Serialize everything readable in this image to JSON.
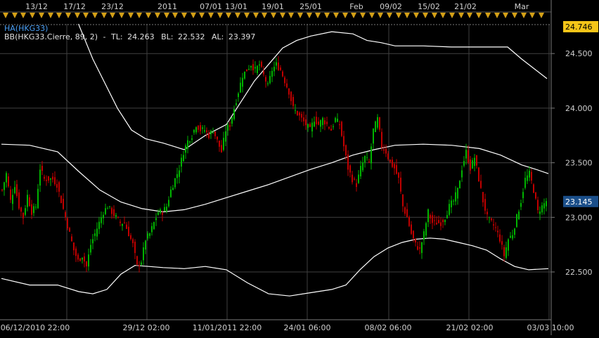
{
  "chart_data": {
    "type": "candlestick",
    "instrument": "HA(HKG33)",
    "indicator": {
      "label": "BB(HKG33.Cierre, 89, 2)",
      "tl_label": "TL:",
      "tl_value": "24.263",
      "bl_label": "BL:",
      "bl_value": "22.532",
      "al_label": "AL:",
      "al_value": "23.397",
      "separator": "-"
    },
    "ylim": [
      22.0,
      24.85
    ],
    "y_ticks": [
      "24.500",
      "24.000",
      "23.500",
      "23.000",
      "22.500"
    ],
    "last_price": "23.145",
    "high_marker": "24.746",
    "top_labels": [
      "13/12",
      "17/12",
      "23/12",
      "2011",
      "07/01",
      "13/01",
      "19/01",
      "25/01",
      "Feb",
      "09/02",
      "15/02",
      "21/02",
      "Mar"
    ],
    "bottom_labels": [
      "06/12/2010 22:00",
      "29/12 02:00",
      "11/01/2011 22:00",
      "24/01 06:00",
      "08/02 06:00",
      "21/02 02:00",
      "03/03 10:00"
    ],
    "close_path": [
      [
        0,
        23.25
      ],
      [
        6,
        23.4
      ],
      [
        12,
        23.15
      ],
      [
        18,
        23.3
      ],
      [
        24,
        23.1
      ],
      [
        30,
        23.0
      ],
      [
        36,
        23.2
      ],
      [
        42,
        23.05
      ],
      [
        48,
        23.1
      ],
      [
        54,
        23.45
      ],
      [
        60,
        23.35
      ],
      [
        66,
        23.35
      ],
      [
        72,
        23.35
      ],
      [
        78,
        23.3
      ],
      [
        84,
        23.15
      ],
      [
        90,
        23.0
      ],
      [
        96,
        22.85
      ],
      [
        102,
        22.7
      ],
      [
        108,
        22.6
      ],
      [
        114,
        22.65
      ],
      [
        120,
        22.55
      ],
      [
        126,
        22.75
      ],
      [
        132,
        22.85
      ],
      [
        138,
        22.95
      ],
      [
        144,
        23.05
      ],
      [
        150,
        23.1
      ],
      [
        156,
        23.05
      ],
      [
        162,
        23.0
      ],
      [
        168,
        22.95
      ],
      [
        174,
        22.95
      ],
      [
        180,
        22.85
      ],
      [
        186,
        22.75
      ],
      [
        192,
        22.55
      ],
      [
        198,
        22.6
      ],
      [
        204,
        22.8
      ],
      [
        210,
        22.85
      ],
      [
        216,
        22.95
      ],
      [
        222,
        23.05
      ],
      [
        228,
        23.05
      ],
      [
        234,
        23.1
      ],
      [
        240,
        23.25
      ],
      [
        246,
        23.35
      ],
      [
        252,
        23.45
      ],
      [
        258,
        23.6
      ],
      [
        264,
        23.7
      ],
      [
        270,
        23.75
      ],
      [
        276,
        23.85
      ],
      [
        282,
        23.8
      ],
      [
        288,
        23.8
      ],
      [
        294,
        23.75
      ],
      [
        300,
        23.8
      ],
      [
        306,
        23.7
      ],
      [
        312,
        23.6
      ],
      [
        318,
        23.8
      ],
      [
        324,
        23.85
      ],
      [
        330,
        24.0
      ],
      [
        336,
        24.15
      ],
      [
        342,
        24.3
      ],
      [
        348,
        24.35
      ],
      [
        354,
        24.4
      ],
      [
        360,
        24.35
      ],
      [
        366,
        24.4
      ],
      [
        372,
        24.3
      ],
      [
        378,
        24.2
      ],
      [
        384,
        24.35
      ],
      [
        390,
        24.4
      ],
      [
        396,
        24.35
      ],
      [
        402,
        24.25
      ],
      [
        408,
        24.15
      ],
      [
        414,
        24.0
      ],
      [
        420,
        23.95
      ],
      [
        426,
        23.9
      ],
      [
        432,
        23.85
      ],
      [
        438,
        23.8
      ],
      [
        444,
        23.9
      ],
      [
        450,
        23.85
      ],
      [
        456,
        23.9
      ],
      [
        462,
        23.85
      ],
      [
        468,
        23.8
      ],
      [
        474,
        23.9
      ],
      [
        480,
        23.85
      ],
      [
        486,
        23.65
      ],
      [
        492,
        23.45
      ],
      [
        498,
        23.35
      ],
      [
        504,
        23.3
      ],
      [
        510,
        23.45
      ],
      [
        516,
        23.55
      ],
      [
        522,
        23.5
      ],
      [
        528,
        23.8
      ],
      [
        534,
        23.9
      ],
      [
        540,
        23.65
      ],
      [
        546,
        23.6
      ],
      [
        552,
        23.5
      ],
      [
        558,
        23.45
      ],
      [
        564,
        23.35
      ],
      [
        570,
        23.1
      ],
      [
        576,
        23.0
      ],
      [
        582,
        22.85
      ],
      [
        588,
        22.75
      ],
      [
        594,
        22.7
      ],
      [
        600,
        22.85
      ],
      [
        606,
        23.05
      ],
      [
        612,
        22.95
      ],
      [
        618,
        22.95
      ],
      [
        624,
        22.95
      ],
      [
        630,
        23.0
      ],
      [
        636,
        23.1
      ],
      [
        642,
        23.15
      ],
      [
        648,
        23.25
      ],
      [
        654,
        23.45
      ],
      [
        660,
        23.6
      ],
      [
        666,
        23.45
      ],
      [
        672,
        23.55
      ],
      [
        678,
        23.35
      ],
      [
        684,
        23.15
      ],
      [
        690,
        23.0
      ],
      [
        696,
        22.95
      ],
      [
        702,
        22.9
      ],
      [
        708,
        22.8
      ],
      [
        714,
        22.65
      ],
      [
        720,
        22.8
      ],
      [
        726,
        22.85
      ],
      [
        732,
        23.0
      ],
      [
        738,
        23.15
      ],
      [
        744,
        23.35
      ],
      [
        750,
        23.4
      ],
      [
        756,
        23.25
      ],
      [
        762,
        23.05
      ],
      [
        768,
        23.1
      ],
      [
        774,
        23.15
      ]
    ],
    "upper_band": [
      [
        95,
        25.0
      ],
      [
        130,
        24.45
      ],
      [
        165,
        24.0
      ],
      [
        185,
        23.8
      ],
      [
        205,
        23.72
      ],
      [
        230,
        23.68
      ],
      [
        260,
        23.62
      ],
      [
        290,
        23.75
      ],
      [
        320,
        23.85
      ],
      [
        340,
        24.05
      ],
      [
        360,
        24.25
      ],
      [
        380,
        24.4
      ],
      [
        400,
        24.55
      ],
      [
        420,
        24.62
      ],
      [
        440,
        24.66
      ],
      [
        470,
        24.7
      ],
      [
        500,
        24.68
      ],
      [
        520,
        24.62
      ],
      [
        540,
        24.6
      ],
      [
        560,
        24.57
      ],
      [
        600,
        24.57
      ],
      [
        640,
        24.56
      ],
      [
        680,
        24.56
      ],
      [
        720,
        24.56
      ],
      [
        740,
        24.45
      ],
      [
        760,
        24.35
      ],
      [
        776,
        24.27
      ]
    ],
    "mid_band": [
      [
        0,
        23.67
      ],
      [
        40,
        23.66
      ],
      [
        80,
        23.6
      ],
      [
        110,
        23.42
      ],
      [
        140,
        23.25
      ],
      [
        170,
        23.14
      ],
      [
        200,
        23.08
      ],
      [
        230,
        23.05
      ],
      [
        260,
        23.07
      ],
      [
        290,
        23.12
      ],
      [
        320,
        23.18
      ],
      [
        350,
        23.24
      ],
      [
        380,
        23.3
      ],
      [
        410,
        23.37
      ],
      [
        440,
        23.44
      ],
      [
        470,
        23.5
      ],
      [
        500,
        23.57
      ],
      [
        530,
        23.62
      ],
      [
        560,
        23.66
      ],
      [
        600,
        23.67
      ],
      [
        640,
        23.66
      ],
      [
        680,
        23.63
      ],
      [
        710,
        23.57
      ],
      [
        740,
        23.48
      ],
      [
        760,
        23.44
      ],
      [
        778,
        23.4
      ]
    ],
    "lower_band": [
      [
        0,
        22.44
      ],
      [
        40,
        22.38
      ],
      [
        80,
        22.38
      ],
      [
        110,
        22.32
      ],
      [
        130,
        22.3
      ],
      [
        150,
        22.34
      ],
      [
        170,
        22.48
      ],
      [
        190,
        22.56
      ],
      [
        210,
        22.55
      ],
      [
        230,
        22.54
      ],
      [
        260,
        22.53
      ],
      [
        290,
        22.55
      ],
      [
        320,
        22.52
      ],
      [
        350,
        22.4
      ],
      [
        380,
        22.3
      ],
      [
        410,
        22.28
      ],
      [
        440,
        22.31
      ],
      [
        470,
        22.34
      ],
      [
        490,
        22.38
      ],
      [
        510,
        22.52
      ],
      [
        530,
        22.64
      ],
      [
        550,
        22.72
      ],
      [
        570,
        22.77
      ],
      [
        590,
        22.8
      ],
      [
        610,
        22.81
      ],
      [
        630,
        22.8
      ],
      [
        650,
        22.77
      ],
      [
        670,
        22.74
      ],
      [
        690,
        22.7
      ],
      [
        710,
        22.62
      ],
      [
        730,
        22.55
      ],
      [
        750,
        22.52
      ],
      [
        778,
        22.53
      ]
    ],
    "colors": {
      "background": "#000000",
      "grid": "#404040",
      "up": "#00b400",
      "down": "#c00000",
      "band": "#ffffff",
      "text": "#cfcfcf",
      "title": "#4a9ff5",
      "marker": "#d4a017",
      "price_box": "#f5c518"
    }
  }
}
